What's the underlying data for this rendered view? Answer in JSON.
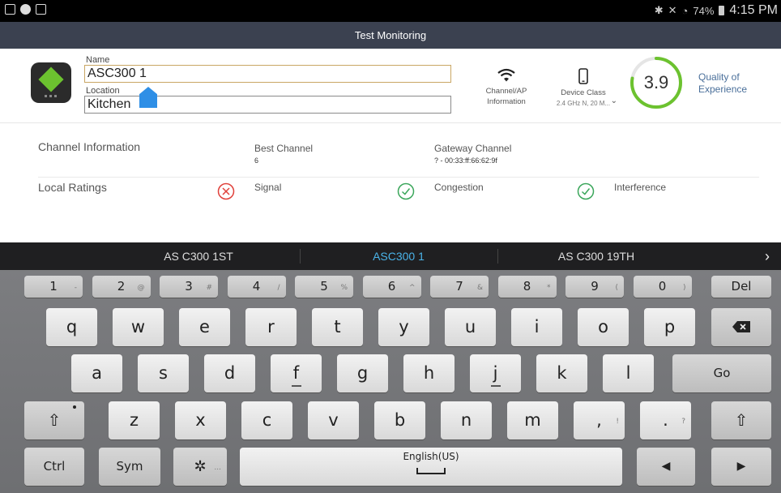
{
  "status": {
    "battery": "74%",
    "time": "4:15 PM"
  },
  "title": "Test Monitoring",
  "device": {
    "name_label": "Name",
    "name_value": "ASC300 1",
    "location_label": "Location",
    "location_value": "Kitchen"
  },
  "header_items": {
    "channel_ap_line1": "Channel/AP",
    "channel_ap_line2": "Information",
    "device_class_label": "Device Class",
    "device_class_sub": "2.4 GHz N, 20 M...",
    "qoe_value": "3.9",
    "qoe_line1": "Quality of",
    "qoe_line2": "Experience"
  },
  "channel_info": {
    "title": "Channel Information",
    "best_label": "Best Channel",
    "best_value": "6",
    "gateway_label": "Gateway Channel",
    "gateway_value": "? - 00:33:ff:66:62:9f"
  },
  "local_ratings": {
    "title": "Local Ratings",
    "signal": "Signal",
    "congestion": "Congestion",
    "interference": "Interference"
  },
  "suggestions": [
    "AS C300 1ST",
    "ASC300 1",
    "AS C300 19TH"
  ],
  "keyboard": {
    "number_row": [
      {
        "k": "1",
        "s": "-"
      },
      {
        "k": "2",
        "s": "@"
      },
      {
        "k": "3",
        "s": "#"
      },
      {
        "k": "4",
        "s": "/"
      },
      {
        "k": "5",
        "s": "%"
      },
      {
        "k": "6",
        "s": "^"
      },
      {
        "k": "7",
        "s": "&"
      },
      {
        "k": "8",
        "s": "*"
      },
      {
        "k": "9",
        "s": "("
      },
      {
        "k": "0",
        "s": ")"
      }
    ],
    "del": "Del",
    "row1": [
      "q",
      "w",
      "e",
      "r",
      "t",
      "y",
      "u",
      "i",
      "o",
      "p"
    ],
    "row2": [
      "a",
      "s",
      "d",
      "f",
      "g",
      "h",
      "j",
      "k",
      "l"
    ],
    "go": "Go",
    "row3": [
      "z",
      "x",
      "c",
      "v",
      "b",
      "n",
      "m"
    ],
    "comma": ",",
    "comma_sup": "!",
    "period": ".",
    "period_sup": "?",
    "ctrl": "Ctrl",
    "sym": "Sym",
    "space_label": "English(US)"
  },
  "colors": {
    "accent_green": "#6cc22f",
    "error_red": "#e0403a",
    "ok_green": "#3aa65a",
    "suggest_active": "#4ab3e8"
  }
}
